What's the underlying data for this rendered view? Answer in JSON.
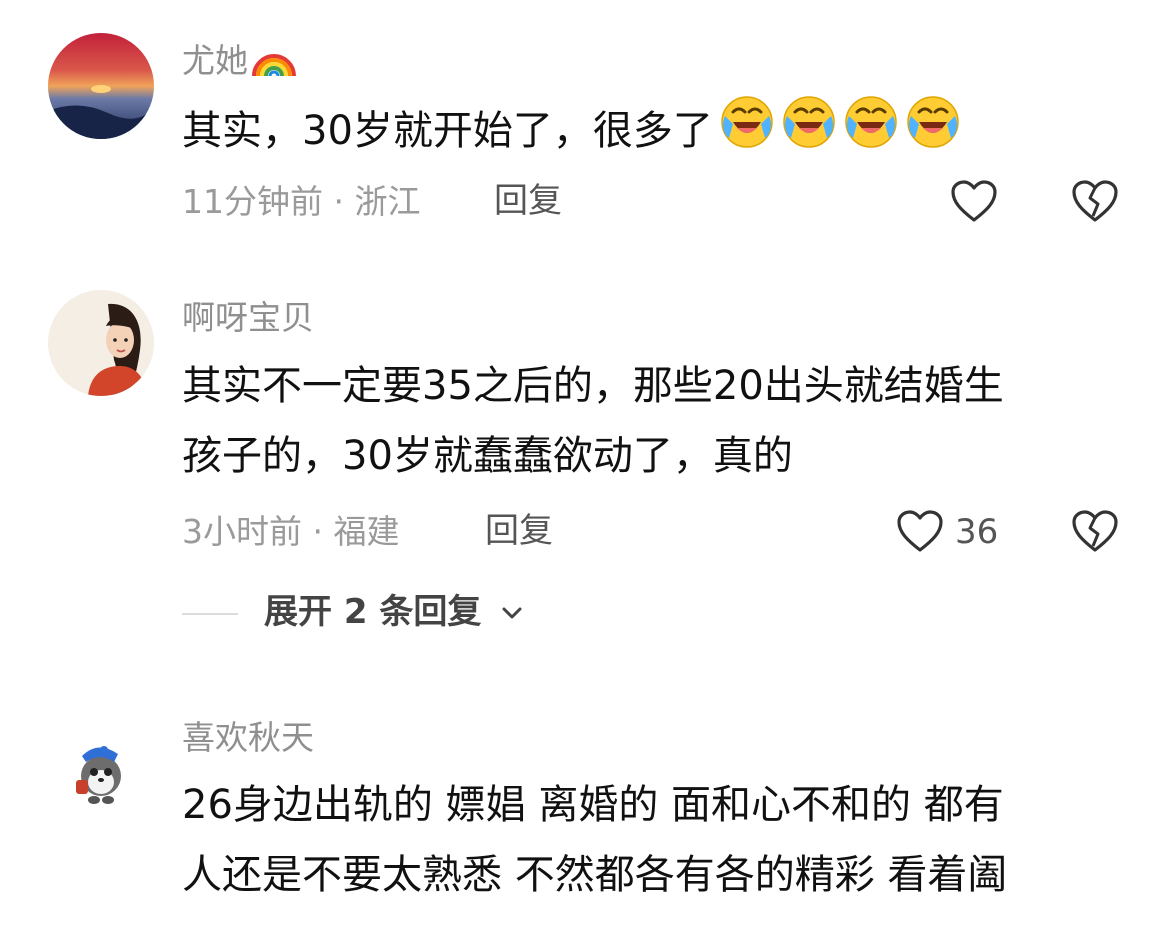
{
  "comments": [
    {
      "username": "尤她",
      "username_emoji": "rainbow-emoji",
      "text": "其实，30岁就开始了，很多了",
      "trailing_emojis": [
        "laugh-cry-emoji",
        "laugh-cry-emoji",
        "laugh-cry-emoji",
        "laugh-cry-emoji"
      ],
      "time_location": "11分钟前 · 浙江",
      "reply_label": "回复",
      "like_count": ""
    },
    {
      "username": "啊呀宝贝",
      "text_line1": "其实不一定要35之后的，那些20出头就结婚生",
      "text_line2": "孩子的，30岁就蠢蠢欲动了，真的",
      "time_location": "3小时前 · 福建",
      "reply_label": "回复",
      "like_count": "36",
      "expand_label": "展开 2 条回复"
    },
    {
      "username": "喜欢秋天",
      "text_line1": "26身边出轨的 嫖娼 离婚的 面和心不和的 都有",
      "text_line2": "人还是不要太熟悉 不然都各有各的精彩 看着阖"
    }
  ],
  "icons": {
    "like": "heart-outline-icon",
    "dislike": "broken-heart-icon",
    "expand": "chevron-down-icon"
  },
  "colors": {
    "username": "#8f8f8f",
    "meta": "#9a9a9a",
    "text": "#111111",
    "reply": "#555555"
  }
}
